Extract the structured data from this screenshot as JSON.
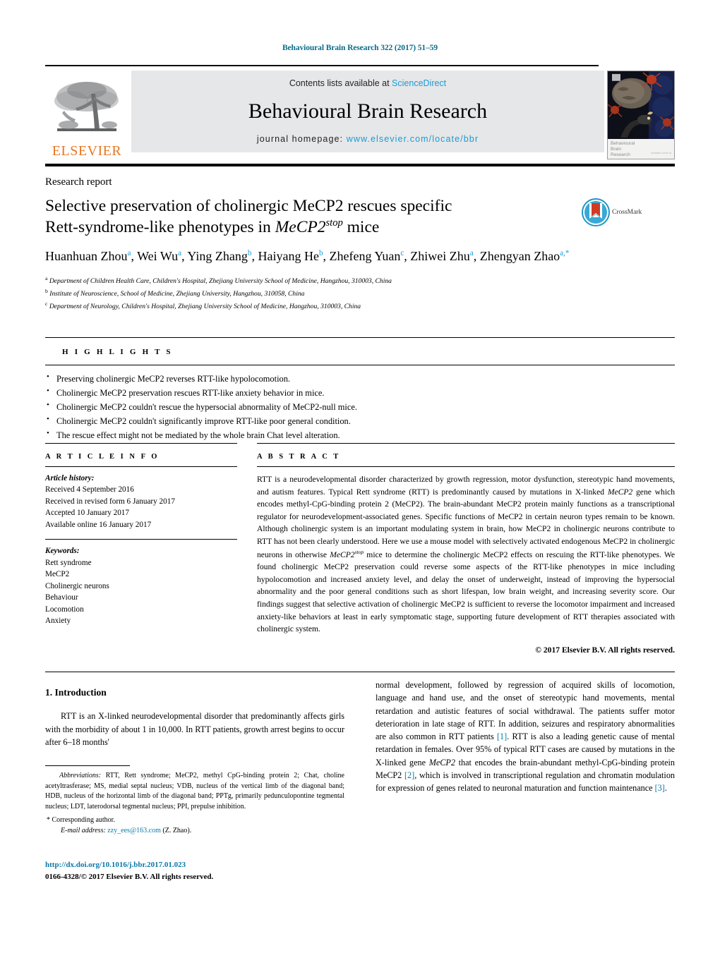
{
  "running_head": "Behavioural Brain Research 322 (2017) 51–59",
  "masthead": {
    "contents_prefix": "Contents lists available at ",
    "contents_link": "ScienceDirect",
    "journal_title": "Behavioural Brain Research",
    "homepage_prefix": "journal homepage: ",
    "homepage_url": "www.elsevier.com/locate/bbr",
    "publisher_logo_text": "ELSEVIER",
    "cover_caption_line1": "Behavioural",
    "cover_caption_line2": "Brain",
    "cover_caption_line3": "Research",
    "cover_caption_tiny": "available online at"
  },
  "article": {
    "doctype": "Research report",
    "title_line1": "Selective preservation of cholinergic MeCP2 rescues specific",
    "title_line2_pre": "Rett-syndrome-like phenotypes in ",
    "title_line2_italic": "MeCP2",
    "title_line2_sup": "stop",
    "title_line2_post": " mice",
    "crossmark_label": "CrossMark",
    "authors": [
      {
        "name": "Huanhuan Zhou",
        "sup": "a",
        "sep": ", "
      },
      {
        "name": "Wei Wu",
        "sup": "a",
        "sep": ", "
      },
      {
        "name": "Ying Zhang",
        "sup": "b",
        "sep": ", "
      },
      {
        "name": "Haiyang He",
        "sup": "b",
        "sep": ", "
      },
      {
        "name": "Zhefeng Yuan",
        "sup": "c",
        "sep": ", "
      },
      {
        "name": "Zhiwei Zhu",
        "sup": "a",
        "sep": ", "
      },
      {
        "name": "Zhengyan Zhao",
        "sup": "a,*",
        "sep": ""
      }
    ],
    "affiliations": [
      {
        "marker": "a",
        "text": "Department of Children Health Care, Children's Hospital, Zhejiang University School of Medicine, Hangzhou, 310003, China"
      },
      {
        "marker": "b",
        "text": "Institute of Neuroscience, School of Medicine, Zhejiang University, Hangzhou, 310058, China"
      },
      {
        "marker": "c",
        "text": "Department of Neurology, Children's Hospital, Zhejiang University School of Medicine, Hangzhou, 310003, China"
      }
    ]
  },
  "highlights": {
    "label": "H I G H L I G H T S",
    "items": [
      "Preserving cholinergic MeCP2 reverses RTT-like hypolocomotion.",
      "Cholinergic MeCP2 preservation rescues RTT-like anxiety behavior in mice.",
      "Cholinergic MeCP2 couldn't rescue the hypersocial abnormality of MeCP2-null mice.",
      "Cholinergic MeCP2 couldn't significantly improve RTT-like poor general condition.",
      "The rescue effect might not be mediated by the whole brain Chat level alteration."
    ]
  },
  "article_info": {
    "label": "A R T I C L E   I N F O",
    "history_label": "Article history:",
    "history": [
      "Received 4 September 2016",
      "Received in revised form 6 January 2017",
      "Accepted 10 January 2017",
      "Available online 16 January 2017"
    ],
    "keywords_label": "Keywords:",
    "keywords": [
      "Rett syndrome",
      "MeCP2",
      "Cholinergic neurons",
      "Behaviour",
      "Locomotion",
      "Anxiety"
    ]
  },
  "abstract": {
    "label": "A B S T R A C T",
    "part1": "RTT is a neurodevelopmental disorder characterized by growth regression, motor dysfunction, stereotypic hand movements, and autism features. Typical Rett syndrome (RTT) is predominantly caused by mutations in X-linked ",
    "italic1": "MeCP2",
    "part2": " gene which encodes methyl-CpG-binding protein 2 (MeCP2). The brain-abundant MeCP2 protein mainly functions as a transcriptional regulator for neurodevelopment-associated genes. Specific functions of MeCP2 in certain neuron types remain to be known. Although cholinergic system is an important modulating system in brain, how MeCP2 in cholinergic neurons contribute to RTT has not been clearly understood. Here we use a mouse model with selectively activated endogenous MeCP2 in cholinergic neurons in otherwise ",
    "italic2": "MeCP2",
    "italic2_sup": "stop",
    "part3": " mice to determine the cholinergic MeCP2 effects on rescuing the RTT-like phenotypes. We found cholinergic MeCP2 preservation could reverse some aspects of the RTT-like phenotypes in mice including hypolocomotion and increased anxiety level, and delay the onset of underweight, instead of improving the hypersocial abnormality and the poor general conditions such as short lifespan, low brain weight, and increasing severity score. Our findings suggest that selective activation of cholinergic MeCP2 is sufficient to reverse the locomotor impairment and increased anxiety-like behaviors at least in early symptomatic stage, supporting future development of RTT therapies associated with cholinergic system.",
    "copyright": "© 2017 Elsevier B.V. All rights reserved."
  },
  "introduction": {
    "heading": "1. Introduction",
    "left_para": "RTT is an X-linked neurodevelopmental disorder that predominantly affects girls with the morbidity of about 1 in 10,000. In RTT patients, growth arrest begins to occur after 6–18 months'",
    "right_part1": "normal development, followed by regression of acquired skills of locomotion, language and hand use, and the onset of stereotypic hand movements, mental retardation and autistic features of social withdrawal. The patients suffer motor deterioration in late stage of RTT. In addition, seizures and respiratory abnormalities are also common in RTT patients ",
    "ref1": "[1]",
    "right_part2": ". RTT is also a leading genetic cause of mental retardation in females. Over 95% of typical RTT cases are caused by mutations in the X-linked gene ",
    "gene_italic": "MeCP2",
    "right_part3": " that encodes the brain-abundant methyl-CpG-binding protein MeCP2 ",
    "ref2": "[2]",
    "right_part4": ", which is involved in transcriptional regulation and chromatin modulation for expression of genes related to neuronal maturation and function maintenance ",
    "ref3": "[3]",
    "right_part5": "."
  },
  "footnotes": {
    "abbrev_label": "Abbreviations:",
    "abbrev_text": " RTT, Rett syndrome; MeCP2, methyl CpG-binding protein 2; Chat, choline acetyltrasferase; MS, medial septal nucleus; VDB, nucleus of the vertical limb of the diagonal band; HDB, nucleus of the horizontal limb of the diagonal band; PPTg, primarily pedunculopontine tegmental nucleus; LDT, laterodorsal tegmental nucleus; PPI, prepulse inhibition.",
    "corresponding_star": "*",
    "corresponding_text": "Corresponding author.",
    "email_label": "E-mail address:",
    "email": "zzy_ees@163.com",
    "email_suffix": " (Z. Zhao)."
  },
  "footer": {
    "doi": "http://dx.doi.org/10.1016/j.bbr.2017.01.023",
    "issn_line": "0166-4328/© 2017 Elsevier B.V. All rights reserved."
  },
  "colors": {
    "link_blue": "#1a9bd7",
    "ref_blue": "#0a78a8",
    "runhead_teal": "#0a6b8a",
    "elsevier_orange": "#e87722",
    "masthead_grey": "#e6e7e8"
  }
}
